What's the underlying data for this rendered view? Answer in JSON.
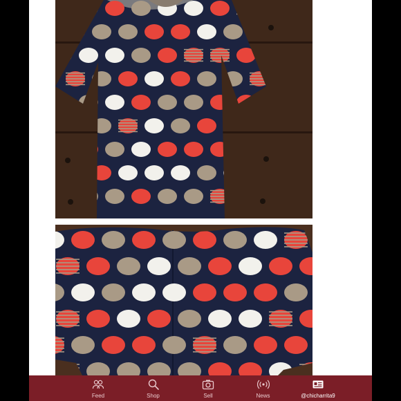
{
  "tabbar": {
    "items": [
      {
        "label": "Feed",
        "icon": "people-icon"
      },
      {
        "label": "Shop",
        "icon": "search-icon"
      },
      {
        "label": "Sell",
        "icon": "camera-icon"
      },
      {
        "label": "News",
        "icon": "broadcast-icon"
      },
      {
        "label": "@chicharrita9",
        "icon": "profile-card-icon"
      }
    ],
    "active_index": 4
  },
  "colors": {
    "frame_background": "#000000",
    "card_background": "#ffffff",
    "tabbar_background": "#7b1e27",
    "dress_navy": "#1c2340",
    "dot_red": "#e8453b",
    "dot_taupe": "#a99a86",
    "dot_white": "#f2f1ec",
    "wood_brown": "#4a2f1f"
  }
}
